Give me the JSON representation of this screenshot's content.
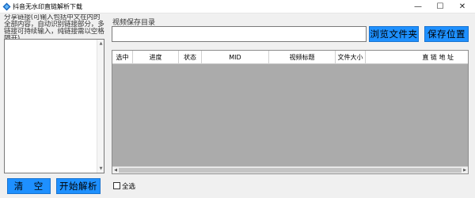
{
  "window": {
    "title": "抖音无水印直链解析下载",
    "minimize_glyph": "—",
    "maximize_glyph": "☐",
    "close_glyph": "✕"
  },
  "left_panel": {
    "share_label": "分享链接(可输入包括中文在内的全部内容，自动识别链接部分，多链接可持续输入，纯链接需以空格隔开)",
    "link_input_value": "",
    "clear_button": "清　空",
    "start_button": "开始解析"
  },
  "save_dir": {
    "label": "视频保存目录",
    "value": "",
    "browse_button": "浏览文件夹",
    "location_button": "保存位置"
  },
  "table": {
    "columns": [
      "选中",
      "进度",
      "状态",
      "MID",
      "视频标题",
      "文件大小",
      "直 链 地 址"
    ],
    "rows": []
  },
  "footer": {
    "select_all_label": "全选",
    "select_all_checked": false
  },
  "colors": {
    "accent_button": "#1e90ff",
    "grid_background": "#ababab",
    "window_background": "#f0f0f0"
  }
}
